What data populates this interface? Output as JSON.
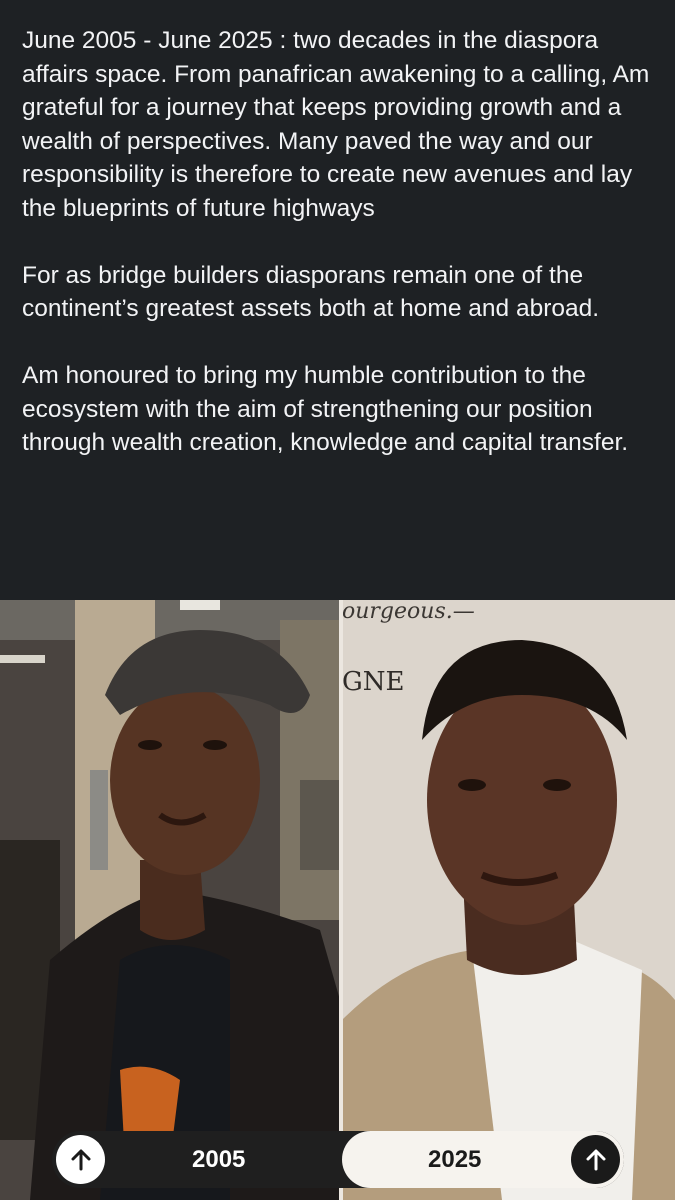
{
  "post": {
    "paragraphs": [
      "June 2005 - June 2025 : two decades in the diaspora affairs space. From panafrican awakening to a calling, Am grateful for a journey that keeps providing growth and a wealth of perspectives. Many paved the way and our responsibility is therefore to create new avenues and lay the blueprints of future highways",
      "For as bridge builders diasporans remain one of the continent’s greatest assets both at home and abroad.",
      "Am honoured to bring my humble contribution to the ecosystem with the aim of strengthening our position through wealth creation, knowledge and capital transfer."
    ]
  },
  "photos": {
    "left_sign": "ourgeous.—",
    "right_sign": "GNE"
  },
  "compare": {
    "left_label": "2005",
    "right_label": "2025",
    "left_icon": "arrow-up-icon",
    "right_icon": "arrow-up-icon",
    "colors": {
      "bar": "#1f1f1f",
      "active": "#f6f3ee",
      "text_bg": "#1e2124"
    }
  }
}
